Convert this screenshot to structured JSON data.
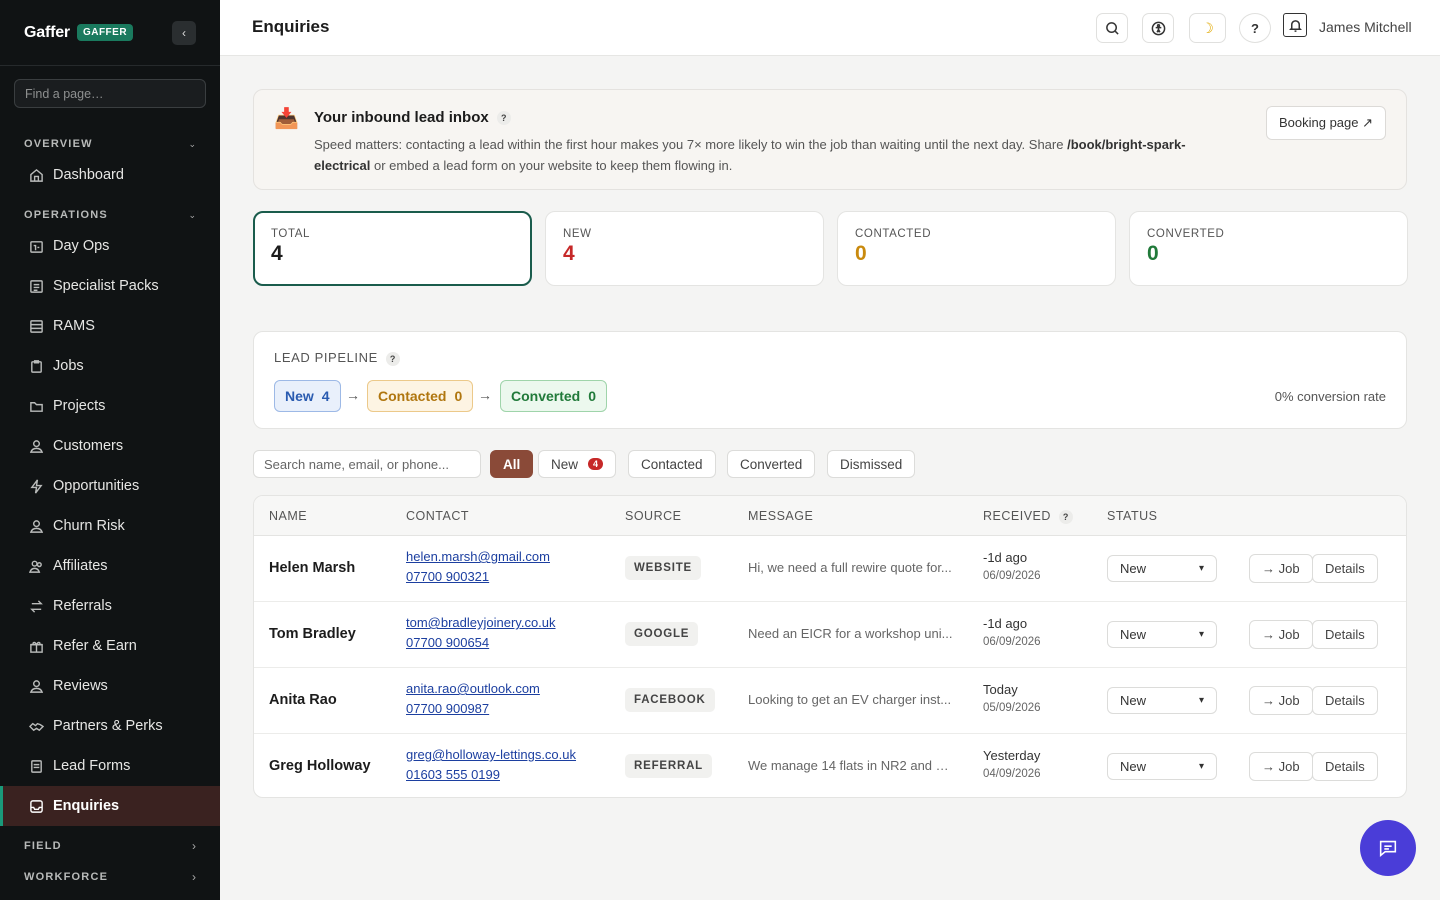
{
  "sidebar": {
    "brand": "Gaffer",
    "badge": "GAFFER",
    "collapse_icon": "‹",
    "search_placeholder": "Find a page…",
    "sections": {
      "overview": "OVERVIEW",
      "operations": "OPERATIONS",
      "field": "FIELD",
      "workforce": "WORKFORCE"
    },
    "items": [
      {
        "label": "Dashboard",
        "icon": "home-icon"
      },
      {
        "label": "Day Ops",
        "icon": "calendar-icon"
      },
      {
        "label": "Specialist Packs",
        "icon": "list-icon"
      },
      {
        "label": "RAMS",
        "icon": "document-icon"
      },
      {
        "label": "Jobs",
        "icon": "clipboard-icon"
      },
      {
        "label": "Projects",
        "icon": "folder-icon"
      },
      {
        "label": "Customers",
        "icon": "user-icon"
      },
      {
        "label": "Opportunities",
        "icon": "bolt-icon"
      },
      {
        "label": "Churn Risk",
        "icon": "user-alert-icon"
      },
      {
        "label": "Affiliates",
        "icon": "users-icon"
      },
      {
        "label": "Referrals",
        "icon": "swap-icon"
      },
      {
        "label": "Refer & Earn",
        "icon": "gift-icon"
      },
      {
        "label": "Reviews",
        "icon": "user-icon"
      },
      {
        "label": "Partners & Perks",
        "icon": "handshake-icon"
      },
      {
        "label": "Lead Forms",
        "icon": "form-icon"
      },
      {
        "label": "Enquiries",
        "icon": "inbox-icon"
      }
    ]
  },
  "header": {
    "title": "Enquiries",
    "help": "?",
    "user": "James Mitchell"
  },
  "banner": {
    "icon": "📥",
    "title": "Your inbound lead inbox",
    "help": "?",
    "text_pre": "Speed matters: contacting a lead within the first hour makes you 7× more likely to win the job than waiting until the next day. Share ",
    "text_link": "/book/bright-spark-electrical",
    "text_post": " or embed a lead form on your website to keep them flowing in.",
    "button": "Booking page ↗"
  },
  "stats": [
    {
      "label": "TOTAL",
      "value": "4",
      "color": "#1c1c1c"
    },
    {
      "label": "NEW",
      "value": "4",
      "color": "#c62828"
    },
    {
      "label": "CONTACTED",
      "value": "0",
      "color": "#c98a0e"
    },
    {
      "label": "CONVERTED",
      "value": "0",
      "color": "#217a3a"
    }
  ],
  "pipeline": {
    "title": "LEAD PIPELINE",
    "help": "?",
    "stages": [
      {
        "label": "New",
        "count": "4"
      },
      {
        "label": "Contacted",
        "count": "0"
      },
      {
        "label": "Converted",
        "count": "0"
      }
    ],
    "arrow": "→",
    "conversion": "0% conversion rate"
  },
  "filters": {
    "search_placeholder": "Search name, email, or phone...",
    "tabs": [
      "All",
      "New",
      "Contacted",
      "Converted",
      "Dismissed"
    ],
    "new_count": "4"
  },
  "table": {
    "columns": [
      "NAME",
      "CONTACT",
      "SOURCE",
      "MESSAGE",
      "RECEIVED",
      "STATUS"
    ],
    "received_help": "?",
    "rows": [
      {
        "name": "Helen Marsh",
        "email": "helen.marsh@gmail.com",
        "phone": "07700 900321",
        "source": "WEBSITE",
        "message": "Hi, we need a full rewire quote for...",
        "received": "-1d ago",
        "date": "06/09/2026",
        "status": "New"
      },
      {
        "name": "Tom Bradley",
        "email": "tom@bradleyjoinery.co.uk",
        "phone": "07700 900654",
        "source": "GOOGLE",
        "message": "Need an EICR for a workshop uni...",
        "received": "-1d ago",
        "date": "06/09/2026",
        "status": "New"
      },
      {
        "name": "Anita Rao",
        "email": "anita.rao@outlook.com",
        "phone": "07700 900987",
        "source": "FACEBOOK",
        "message": "Looking to get an EV charger inst...",
        "received": "Today",
        "date": "05/09/2026",
        "status": "New"
      },
      {
        "name": "Greg Holloway",
        "email": "greg@holloway-lettings.co.uk",
        "phone": "01603 555 0199",
        "source": "REFERRAL",
        "message": "We manage 14 flats in NR2 and w...",
        "received": "Yesterday",
        "date": "04/09/2026",
        "status": "New"
      }
    ],
    "job_button": "→ Job",
    "details_button": "Details",
    "select_chevron": "▾"
  }
}
